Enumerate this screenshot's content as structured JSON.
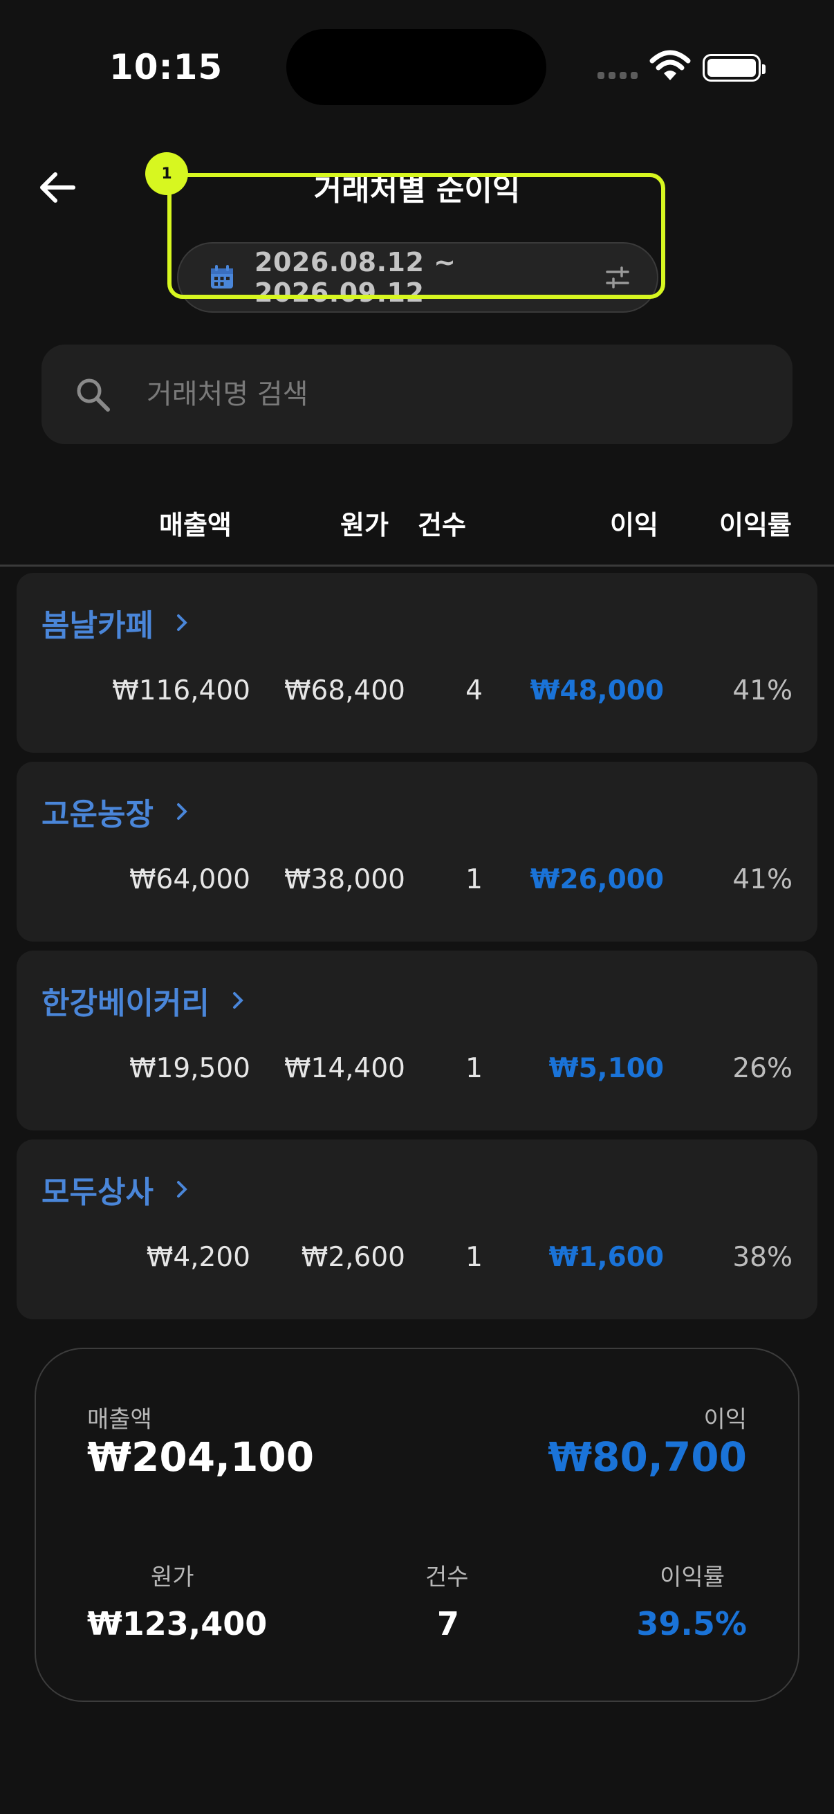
{
  "status": {
    "time": "10:15"
  },
  "header": {
    "title": "거래처별 순이익",
    "date_range": "2026.08.12 ~ 2026.09.12"
  },
  "annotation": {
    "badge": "1"
  },
  "search": {
    "placeholder": "거래처명 검색",
    "value": ""
  },
  "columns": {
    "sales": "매출액",
    "cost": "원가",
    "count": "건수",
    "profit": "이익",
    "rate": "이익률"
  },
  "rows": [
    {
      "name": "봄날카페",
      "sales": "₩116,400",
      "cost": "₩68,400",
      "count": "4",
      "profit": "₩48,000",
      "rate": "41%"
    },
    {
      "name": "고운농장",
      "sales": "₩64,000",
      "cost": "₩38,000",
      "count": "1",
      "profit": "₩26,000",
      "rate": "41%"
    },
    {
      "name": "한강베이커리",
      "sales": "₩19,500",
      "cost": "₩14,400",
      "count": "1",
      "profit": "₩5,100",
      "rate": "26%"
    },
    {
      "name": "모두상사",
      "sales": "₩4,200",
      "cost": "₩2,600",
      "count": "1",
      "profit": "₩1,600",
      "rate": "38%"
    }
  ],
  "summary": {
    "sales_label": "매출액",
    "sales_value": "₩204,100",
    "profit_label": "이익",
    "profit_value": "₩80,700",
    "cost_label": "원가",
    "cost_value": "₩123,400",
    "count_label": "건수",
    "count_value": "7",
    "rate_label": "이익률",
    "rate_value": "39.5%"
  },
  "colors": {
    "accent": "#1a73d8",
    "name_link": "#4a86d9",
    "highlight": "#d7f720",
    "background": "#121212"
  }
}
